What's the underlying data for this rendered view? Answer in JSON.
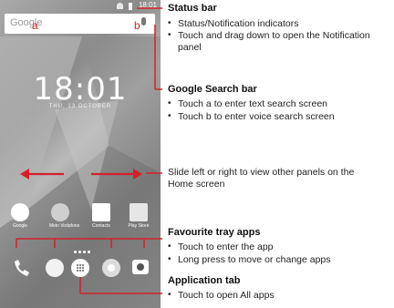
{
  "phone": {
    "status_time": "18:01",
    "search_placeholder": "Google",
    "label_a": "a",
    "label_b": "b",
    "clock": "18:01",
    "date": "THU, 13 OCTOBER",
    "apps": [
      {
        "label": "Google",
        "color": "#ffffff"
      },
      {
        "label": "Mein Vodafone",
        "color": "#cfcfcf"
      },
      {
        "label": "Contacts",
        "color": "#ffffff"
      },
      {
        "label": "Play Store",
        "color": "#e6e6e6"
      }
    ]
  },
  "annotations": {
    "status_bar": {
      "title": "Status bar",
      "bullets": [
        "Status/Notification indicators",
        "Touch and drag down to open the Notification panel"
      ]
    },
    "google_search_bar": {
      "title": "Google Search bar",
      "bullets": [
        "Touch a to enter text search screen",
        "Touch b to enter voice search screen"
      ]
    },
    "slide": {
      "text": "Slide left or right to view other panels on the Home screen"
    },
    "favourite_tray": {
      "title": "Favourite tray apps",
      "bullets": [
        "Touch to enter the app",
        "Long press to move or change apps"
      ]
    },
    "application_tab": {
      "title": "Application tab",
      "bullets": [
        "Touch to open All apps"
      ]
    }
  },
  "colors": {
    "accent_red": "#d5202b",
    "text": "#222222"
  }
}
